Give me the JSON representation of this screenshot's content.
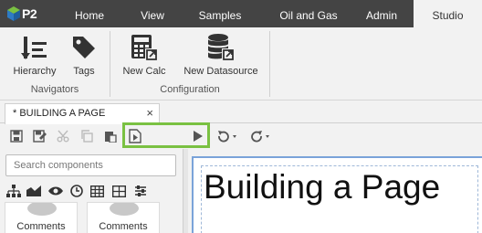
{
  "app": {
    "logo_text": "P2",
    "nav_tabs": [
      {
        "label": "Home"
      },
      {
        "label": "View"
      },
      {
        "label": "Samples"
      },
      {
        "label": "Oil and Gas"
      },
      {
        "label": "Admin"
      },
      {
        "label": "Studio",
        "active": true
      }
    ]
  },
  "ribbon": {
    "groups": [
      {
        "label": "Navigators",
        "buttons": [
          {
            "label": "Hierarchy",
            "icon": "hierarchy-icon"
          },
          {
            "label": "Tags",
            "icon": "tag-icon"
          }
        ]
      },
      {
        "label": "Configuration",
        "buttons": [
          {
            "label": "New Calc",
            "icon": "calculator-icon"
          },
          {
            "label": "New Datasource",
            "icon": "database-icon"
          }
        ]
      }
    ]
  },
  "document_tab": {
    "label": "* BUILDING A PAGE",
    "close": "×"
  },
  "toolbar": {
    "icons": [
      "save-icon",
      "save-as-icon",
      "cut-icon",
      "copy-icon",
      "paste-icon",
      "preview-icon",
      "play-icon",
      "undo-icon",
      "redo-icon"
    ]
  },
  "components_panel": {
    "search_placeholder": "Search components",
    "category_icons": [
      "hierarchy-icon",
      "area-chart-icon",
      "eye-icon",
      "clock-icon",
      "table-icon",
      "grid-icon",
      "sliders-icon"
    ],
    "items": [
      {
        "label": "Comments"
      },
      {
        "label": "Comments"
      }
    ]
  },
  "canvas": {
    "page_title": "Building a Page"
  },
  "colors": {
    "nav_bg": "#444444",
    "highlight": "#7ac142",
    "canvas_border": "#7aa3d9"
  }
}
